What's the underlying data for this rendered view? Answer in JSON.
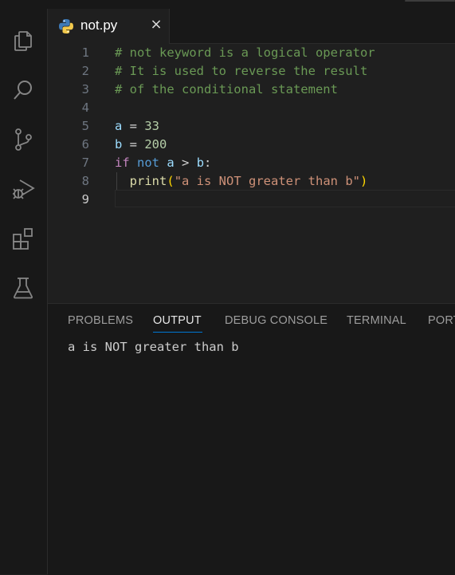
{
  "activity_bar": {
    "icons": [
      "files-icon",
      "search-icon",
      "source-control-icon",
      "run-debug-icon",
      "extensions-icon",
      "testing-icon"
    ]
  },
  "editor": {
    "tab": {
      "label": "not.py",
      "close": "×",
      "icon": "python-icon"
    },
    "active_line": 9,
    "lines": [
      {
        "n": "1",
        "tokens": [
          {
            "t": "# not keyword is a logical operator",
            "c": "c-com"
          }
        ]
      },
      {
        "n": "2",
        "tokens": [
          {
            "t": "# It is used to reverse the result",
            "c": "c-com"
          }
        ]
      },
      {
        "n": "3",
        "tokens": [
          {
            "t": "# of the conditional statement",
            "c": "c-com"
          }
        ]
      },
      {
        "n": "4",
        "tokens": []
      },
      {
        "n": "5",
        "tokens": [
          {
            "t": "a",
            "c": "c-var"
          },
          {
            "t": " = ",
            "c": "c-op"
          },
          {
            "t": "33",
            "c": "c-num"
          }
        ]
      },
      {
        "n": "6",
        "tokens": [
          {
            "t": "b",
            "c": "c-var"
          },
          {
            "t": " = ",
            "c": "c-op"
          },
          {
            "t": "200",
            "c": "c-num"
          }
        ]
      },
      {
        "n": "7",
        "tokens": [
          {
            "t": "if",
            "c": "c-kw"
          },
          {
            "t": " ",
            "c": "c-op"
          },
          {
            "t": "not",
            "c": "c-not"
          },
          {
            "t": " ",
            "c": "c-op"
          },
          {
            "t": "a",
            "c": "c-var"
          },
          {
            "t": " > ",
            "c": "c-op"
          },
          {
            "t": "b",
            "c": "c-var"
          },
          {
            "t": ":",
            "c": "c-op"
          }
        ]
      },
      {
        "n": "8",
        "tokens": [
          {
            "t": "  ",
            "c": "c-op"
          },
          {
            "t": "print",
            "c": "c-fn"
          },
          {
            "t": "(",
            "c": "c-br"
          },
          {
            "t": "\"a is NOT greater than b\"",
            "c": "c-str"
          },
          {
            "t": ")",
            "c": "c-br"
          }
        ]
      },
      {
        "n": "9",
        "tokens": []
      }
    ]
  },
  "panel": {
    "tabs": [
      {
        "label": "PROBLEMS"
      },
      {
        "label": "OUTPUT"
      },
      {
        "label": "DEBUG CONSOLE"
      },
      {
        "label": "TERMINAL"
      },
      {
        "label": "PORT"
      }
    ],
    "active_tab": "OUTPUT",
    "output": "a is NOT greater than b"
  },
  "colors": {
    "accent": "#0078d4",
    "editor_bg": "#1f1f1f",
    "chrome_bg": "#181818"
  }
}
